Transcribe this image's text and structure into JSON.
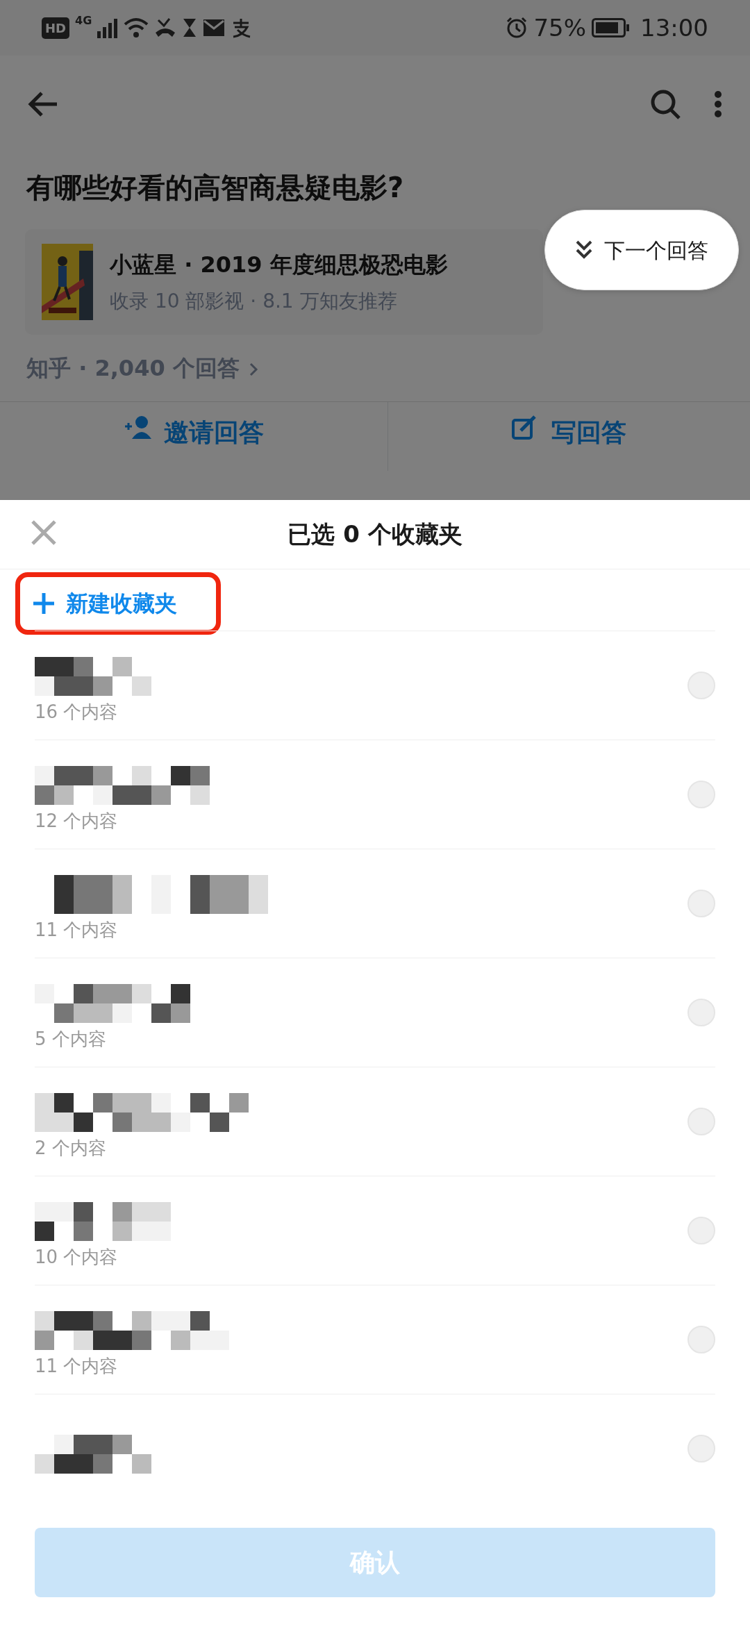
{
  "status_bar": {
    "hd": "HD",
    "network": "4G",
    "battery_percent": "75%",
    "time": "13:00"
  },
  "page": {
    "question": "有哪些好看的高智商悬疑电影?",
    "collection_card": {
      "title": "小蓝星 · 2019 年度细思极恐电影",
      "subtitle": "收录 10 部影视 · 8.1 万知友推荐"
    },
    "next_answer": "下一个回答",
    "source": "知乎 · 2,040 个回答",
    "actions": [
      "邀请回答",
      "写回答"
    ]
  },
  "sheet": {
    "title": "已选 0 个收藏夹",
    "new_folder": "新建收藏夹",
    "highlighted": true,
    "folders": [
      {
        "count": "16 个内容",
        "selected": false
      },
      {
        "count": "12 个内容",
        "selected": false
      },
      {
        "count": "11 个内容",
        "selected": false
      },
      {
        "count": "5 个内容",
        "selected": false
      },
      {
        "count": "2 个内容",
        "selected": false
      },
      {
        "count": "10 个内容",
        "selected": false
      },
      {
        "count": "11 个内容",
        "selected": false
      },
      {
        "selected": false
      }
    ],
    "confirm": {
      "label": "确认",
      "disabled": true
    }
  }
}
